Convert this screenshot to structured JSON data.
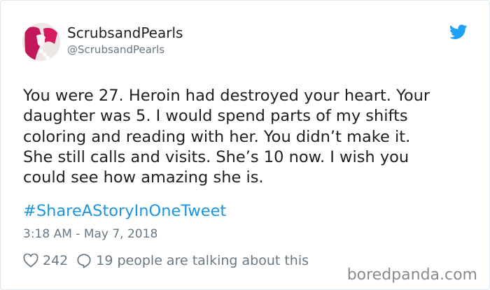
{
  "author": {
    "display_name": "ScrubsandPearls",
    "handle": "@ScrubsandPearls"
  },
  "tweet": {
    "text": "You were 27. Heroin had destroyed your heart. Your\ndaughter was 5. I would spend parts of my shifts\ncoloring and reading with her. You didn’t make it.\nShe still calls and visits. She’s 10 now. I wish you\ncould see how amazing she is.",
    "hashtag": "#ShareAStoryInOneTweet",
    "timestamp": "3:18 AM - May 7, 2018"
  },
  "actions": {
    "likes": "242",
    "talking": "19 people are talking about this"
  },
  "watermark": "boredpanda.com",
  "colors": {
    "link": "#1b95e0",
    "muted": "#697882",
    "text": "#1c2022"
  },
  "icons": [
    "twitter-bird-icon",
    "heart-icon",
    "reply-bubble-icon"
  ]
}
